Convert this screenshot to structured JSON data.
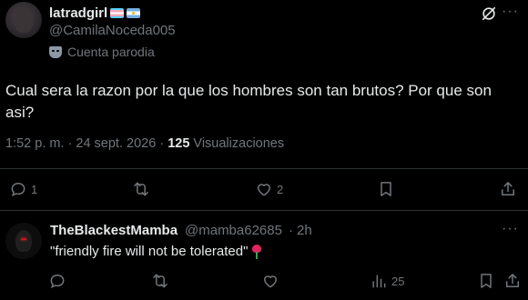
{
  "post": {
    "display_name": "latradgirl",
    "flags": [
      "transgender-flag",
      "argentina-flag"
    ],
    "handle": "@CamilaNoceda005",
    "parody_label": "Cuenta parodia",
    "text": "Cual sera la razon por la que los hombres son tan brutos? Por que son asi?",
    "time": "1:52 p. m.",
    "date": "24 sept. 2026",
    "views_count": "125",
    "views_label": "Visualizaciones",
    "separator": "·",
    "actions": {
      "replies": "1",
      "retweets": "",
      "likes": "2"
    }
  },
  "reply": {
    "display_name": "TheBlackestMamba",
    "handle": "@mamba62685",
    "separator": "·",
    "time": "2h",
    "text": "\"friendly fire will not be tolerated\"",
    "emoji": "rose-icon",
    "actions": {
      "replies": "",
      "retweets": "",
      "likes": "",
      "views": "25"
    }
  },
  "colors": {
    "background": "#000000",
    "text_primary": "#e7e9ea",
    "text_secondary": "#71767b",
    "divider": "#2f3336"
  }
}
